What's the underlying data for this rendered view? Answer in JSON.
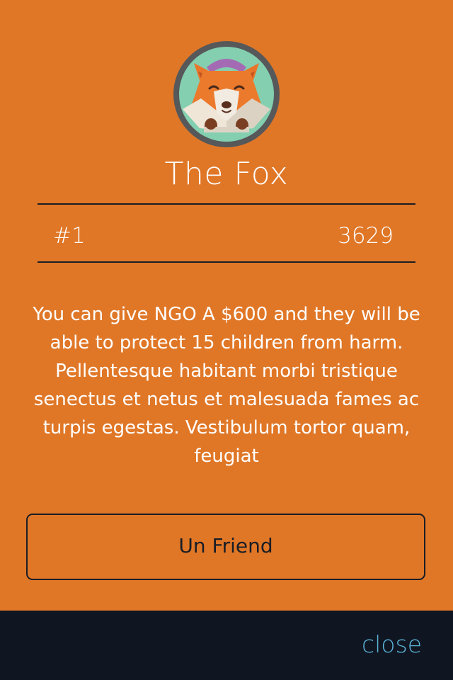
{
  "profile": {
    "avatar_icon": "fox-icon",
    "name": "The Fox"
  },
  "stats": {
    "rank": "#1",
    "score": "3629"
  },
  "description": "You can give NGO A $600 and they will be able to protect 15 children from harm. Pellentesque habitant morbi tristique senectus et netus et malesuada fames ac turpis egestas. Vestibulum tortor quam, feugiat",
  "actions": {
    "unfriend_label": "Un Friend"
  },
  "footer": {
    "close_label": "close"
  },
  "colors": {
    "background": "#e07727",
    "footer": "#0f1521",
    "close_text": "#5ab3d6",
    "avatar_ring": "#56585a",
    "avatar_bg": "#83cfb0",
    "fox_orange": "#e8752a"
  }
}
